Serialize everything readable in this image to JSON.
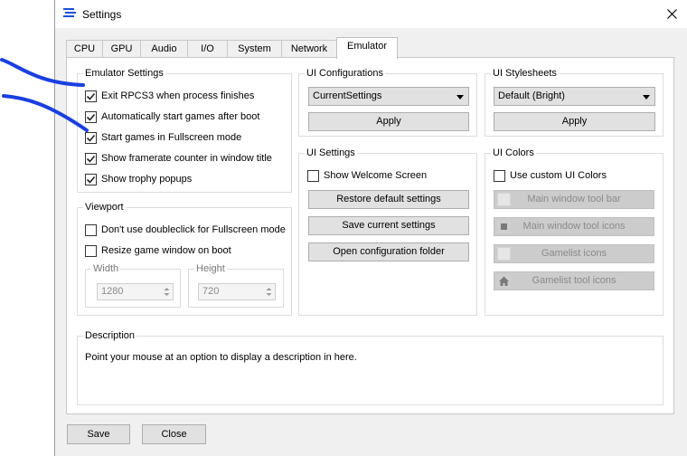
{
  "window": {
    "title": "Settings"
  },
  "tabs": [
    "CPU",
    "GPU",
    "Audio",
    "I/O",
    "System",
    "Network",
    "Emulator"
  ],
  "active_tab": "Emulator",
  "emulator_settings": {
    "title": "Emulator Settings",
    "options": [
      {
        "label": "Exit RPCS3 when process finishes",
        "checked": true
      },
      {
        "label": "Automatically start games after boot",
        "checked": true
      },
      {
        "label": "Start games in Fullscreen mode",
        "checked": true
      },
      {
        "label": "Show framerate counter in window title",
        "checked": true
      },
      {
        "label": "Show trophy popups",
        "checked": true
      }
    ]
  },
  "viewport": {
    "title": "Viewport",
    "options": [
      {
        "label": "Don't use doubleclick for Fullscreen mode",
        "checked": false
      },
      {
        "label": "Resize game window on boot",
        "checked": false
      }
    ],
    "width": {
      "label": "Width",
      "value": "1280"
    },
    "height": {
      "label": "Height",
      "value": "720"
    }
  },
  "ui_configurations": {
    "title": "UI Configurations",
    "selected": "CurrentSettings",
    "apply_label": "Apply"
  },
  "ui_stylesheets": {
    "title": "UI Stylesheets",
    "selected": "Default (Bright)",
    "apply_label": "Apply"
  },
  "ui_settings": {
    "title": "UI Settings",
    "show_welcome_label": "Show Welcome Screen",
    "show_welcome_checked": false,
    "restore_label": "Restore default settings",
    "save_current_label": "Save current settings",
    "open_folder_label": "Open configuration folder"
  },
  "ui_colors": {
    "title": "UI Colors",
    "custom_label": "Use custom UI Colors",
    "custom_checked": false,
    "buttons": [
      "Main window tool bar",
      "Main window tool icons",
      "Gamelist icons",
      "Gamelist tool icons"
    ]
  },
  "description": {
    "title": "Description",
    "text": "Point your mouse at an option to display a description in here."
  },
  "footer": {
    "save_label": "Save",
    "close_label": "Close"
  },
  "colors": {
    "accent": "#1e4fd8",
    "scribble": "#1a3fe0"
  }
}
